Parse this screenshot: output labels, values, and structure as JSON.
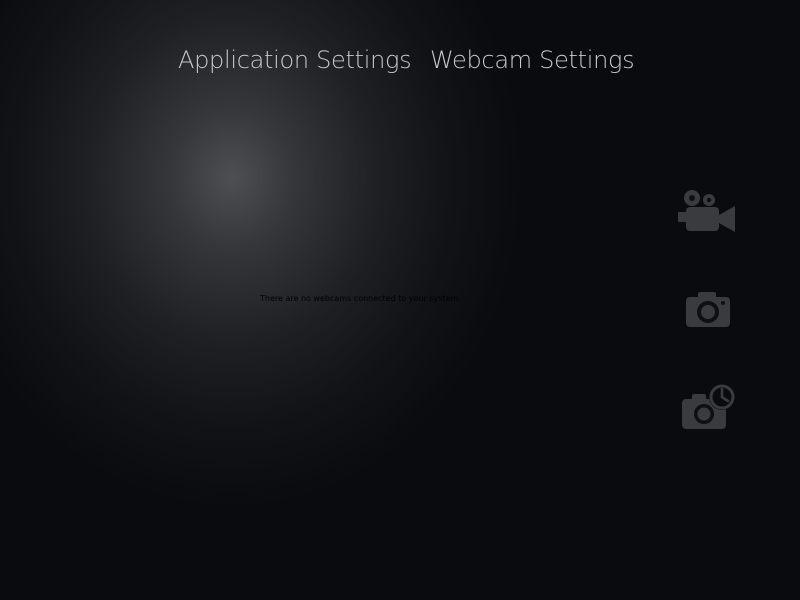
{
  "tabs": {
    "application_settings": "Application Settings",
    "webcam_settings": "Webcam Settings"
  },
  "status": {
    "message": "There are no webcams connected to your system."
  },
  "actions": [
    {
      "name": "record-video",
      "icon": "video-camera-icon"
    },
    {
      "name": "take-photo",
      "icon": "camera-icon"
    },
    {
      "name": "timer-photo",
      "icon": "camera-timer-icon"
    }
  ],
  "colors": {
    "background": "#0a0b0f",
    "highlight": "#4e4f52",
    "tab_text": "#c8c9cc",
    "icon": "#3a3b3e"
  }
}
